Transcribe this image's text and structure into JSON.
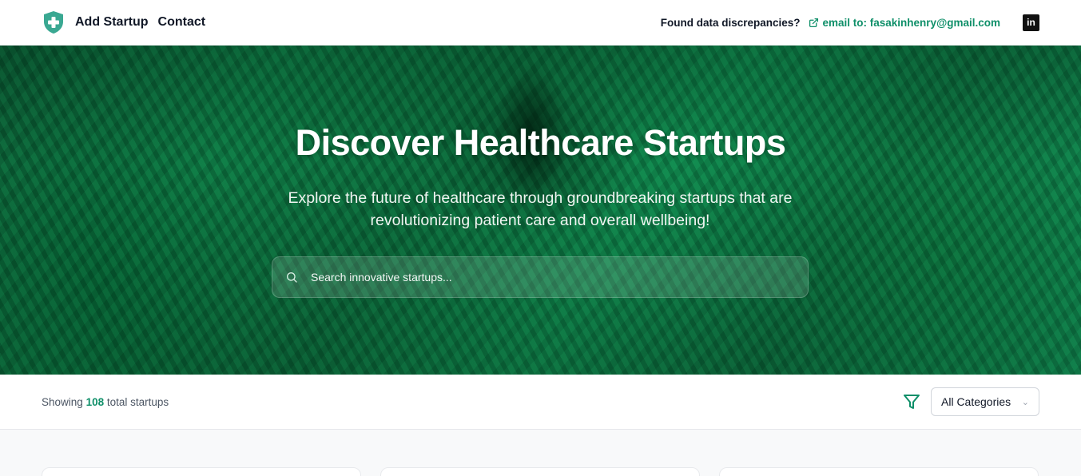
{
  "header": {
    "nav": [
      "Add Startup",
      "Contact"
    ],
    "discrepancy_label": "Found data discrepancies?",
    "email_label": "email to: fasakinhenry@gmail.com",
    "linkedin_text": "in",
    "brand_color": "#0f8f69"
  },
  "hero": {
    "title": "Discover Healthcare Startups",
    "subtitle": "Explore the future of healthcare through groundbreaking startups that are revolutionizing patient care and overall wellbeing!",
    "search_placeholder": "Search innovative startups..."
  },
  "filters": {
    "showing_prefix": "Showing",
    "count": "108",
    "showing_suffix": "total startups",
    "category_selected": "All Categories"
  }
}
